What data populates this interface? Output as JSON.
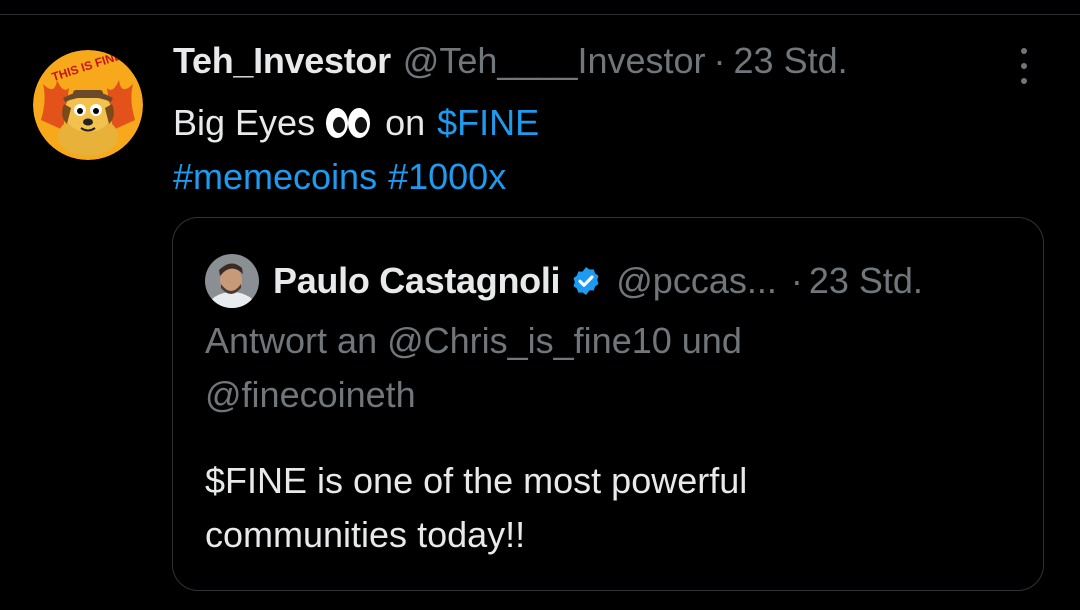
{
  "tweet": {
    "author_name": "Teh_Investor",
    "author_handle": "@Teh____Investor",
    "separator": "·",
    "time": "23 Std.",
    "avatar_text": "THIS IS FINE",
    "text_before_emoji": "Big Eyes",
    "emoji": "eyes-emoji",
    "text_after_emoji": "on",
    "cashtag": "$FINE",
    "hashtag_1": "#memecoins",
    "hashtag_2": "#1000x",
    "more_icon": "more-vertical-icon"
  },
  "quoted_tweet": {
    "author_name": "Paulo Castagnoli",
    "verified_icon": "verified-badge-icon",
    "author_handle": "@pccas...",
    "separator": "·",
    "time": "23 Std.",
    "reply_line_1": "Antwort an @Chris_is_fine10 und",
    "reply_line_2": "@finecoineth",
    "body_line_1": "$FINE is one of the most powerful",
    "body_line_2": "communities today!!"
  },
  "colors": {
    "background": "#000000",
    "text": "#e7e9ea",
    "secondary": "#71767b",
    "link": "#1d9bf0",
    "border": "#2f3336"
  }
}
